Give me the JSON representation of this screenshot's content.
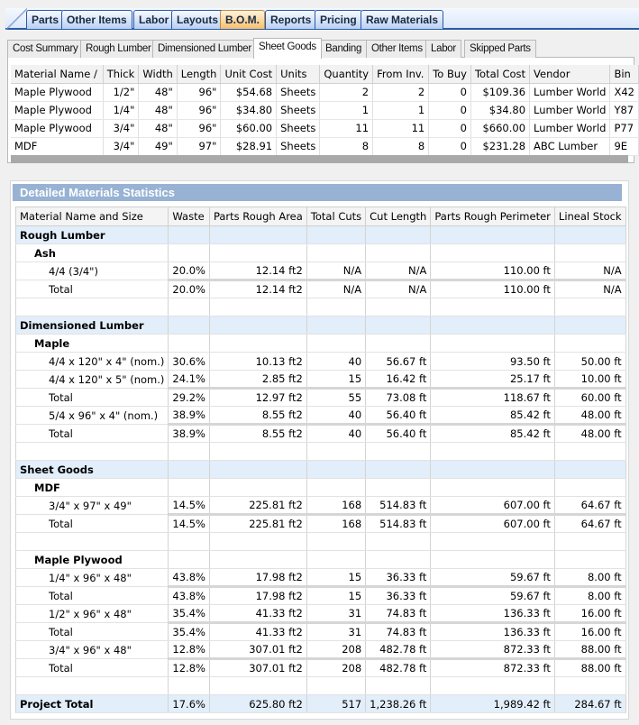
{
  "main_tabs": [
    {
      "label": "Parts",
      "active": false
    },
    {
      "label": "Other Items",
      "active": false
    },
    {
      "label": "Labor",
      "active": false
    },
    {
      "label": "Layouts",
      "active": false
    },
    {
      "label": "B.O.M.",
      "active": true
    },
    {
      "label": "Reports",
      "active": false
    },
    {
      "label": "Pricing",
      "active": false
    },
    {
      "label": "Raw Materials",
      "active": false
    }
  ],
  "sub_tabs": [
    {
      "label": "Cost Summary",
      "active": false
    },
    {
      "label": "Rough Lumber",
      "active": false
    },
    {
      "label": "Dimensioned Lumber",
      "active": false
    },
    {
      "label": "Sheet Goods",
      "active": true
    },
    {
      "label": "Banding",
      "active": false
    },
    {
      "label": "Other Items",
      "active": false
    },
    {
      "label": "Labor",
      "active": false
    },
    {
      "label": "Skipped Parts",
      "active": false
    }
  ],
  "bom_table": {
    "columns": [
      "Material Name /",
      "Thick",
      "Width",
      "Length",
      "Unit Cost",
      "Units",
      "Quantity",
      "From Inv.",
      "To Buy",
      "Total Cost",
      "Vendor",
      "Bin"
    ],
    "rows": [
      [
        "Maple Plywood",
        "1/2\"",
        "48\"",
        "96\"",
        "$54.68",
        "Sheets",
        "2",
        "2",
        "0",
        "$109.36",
        "Lumber World",
        "X42"
      ],
      [
        "Maple Plywood",
        "1/4\"",
        "48\"",
        "96\"",
        "$34.80",
        "Sheets",
        "1",
        "1",
        "0",
        "$34.80",
        "Lumber World",
        "Y87"
      ],
      [
        "Maple Plywood",
        "3/4\"",
        "48\"",
        "96\"",
        "$60.00",
        "Sheets",
        "11",
        "11",
        "0",
        "$660.00",
        "Lumber World",
        "P77"
      ],
      [
        "MDF",
        "3/4\"",
        "49\"",
        "97\"",
        "$28.91",
        "Sheets",
        "8",
        "8",
        "0",
        "$231.28",
        "ABC Lumber",
        "9E"
      ]
    ]
  },
  "stats": {
    "title": "Detailed Materials Statistics",
    "columns": [
      "Material Name and Size",
      "Waste",
      "Parts Rough Area",
      "Total Cuts",
      "Cut Length",
      "Parts Rough Perimeter",
      "Lineal Stock"
    ],
    "rows": [
      {
        "type": "cat",
        "cells": [
          "Rough Lumber",
          "",
          "",
          "",
          "",
          "",
          ""
        ]
      },
      {
        "type": "sub",
        "cells": [
          "Ash",
          "",
          "",
          "",
          "",
          "",
          ""
        ]
      },
      {
        "type": "item",
        "cells": [
          "4/4 (3/4\")",
          "20.0%",
          "12.14 ft2",
          "N/A",
          "N/A",
          "110.00 ft",
          "N/A"
        ]
      },
      {
        "type": "total",
        "cells": [
          "Total",
          "20.0%",
          "12.14 ft2",
          "N/A",
          "N/A",
          "110.00 ft",
          "N/A"
        ]
      },
      {
        "type": "blank",
        "cells": [
          "",
          "",
          "",
          "",
          "",
          "",
          ""
        ]
      },
      {
        "type": "cat",
        "cells": [
          "Dimensioned Lumber",
          "",
          "",
          "",
          "",
          "",
          ""
        ]
      },
      {
        "type": "sub",
        "cells": [
          "Maple",
          "",
          "",
          "",
          "",
          "",
          ""
        ]
      },
      {
        "type": "item",
        "cells": [
          "4/4 x 120\" x 4\" (nom.)",
          "30.6%",
          "10.13 ft2",
          "40",
          "56.67 ft",
          "93.50 ft",
          "50.00 ft"
        ]
      },
      {
        "type": "item",
        "cells": [
          "4/4 x 120\" x 5\" (nom.)",
          "24.1%",
          "2.85 ft2",
          "15",
          "16.42 ft",
          "25.17 ft",
          "10.00 ft"
        ]
      },
      {
        "type": "total",
        "cells": [
          "Total",
          "29.2%",
          "12.97 ft2",
          "55",
          "73.08 ft",
          "118.67 ft",
          "60.00 ft"
        ]
      },
      {
        "type": "item",
        "cells": [
          "5/4 x 96\" x 4\" (nom.)",
          "38.9%",
          "8.55 ft2",
          "40",
          "56.40 ft",
          "85.42 ft",
          "48.00 ft"
        ]
      },
      {
        "type": "total",
        "cells": [
          "Total",
          "38.9%",
          "8.55 ft2",
          "40",
          "56.40 ft",
          "85.42 ft",
          "48.00 ft"
        ]
      },
      {
        "type": "blank",
        "cells": [
          "",
          "",
          "",
          "",
          "",
          "",
          ""
        ]
      },
      {
        "type": "cat",
        "cells": [
          "Sheet Goods",
          "",
          "",
          "",
          "",
          "",
          ""
        ]
      },
      {
        "type": "sub",
        "cells": [
          "MDF",
          "",
          "",
          "",
          "",
          "",
          ""
        ]
      },
      {
        "type": "item",
        "cells": [
          "3/4\" x 97\" x 49\"",
          "14.5%",
          "225.81 ft2",
          "168",
          "514.83 ft",
          "607.00 ft",
          "64.67 ft"
        ]
      },
      {
        "type": "total",
        "cells": [
          "Total",
          "14.5%",
          "225.81 ft2",
          "168",
          "514.83 ft",
          "607.00 ft",
          "64.67 ft"
        ]
      },
      {
        "type": "blank",
        "cells": [
          "",
          "",
          "",
          "",
          "",
          "",
          ""
        ]
      },
      {
        "type": "sub",
        "cells": [
          "Maple Plywood",
          "",
          "",
          "",
          "",
          "",
          ""
        ]
      },
      {
        "type": "item",
        "cells": [
          "1/4\" x 96\" x 48\"",
          "43.8%",
          "17.98 ft2",
          "15",
          "36.33 ft",
          "59.67 ft",
          "8.00 ft"
        ]
      },
      {
        "type": "total",
        "cells": [
          "Total",
          "43.8%",
          "17.98 ft2",
          "15",
          "36.33 ft",
          "59.67 ft",
          "8.00 ft"
        ]
      },
      {
        "type": "item",
        "cells": [
          "1/2\" x 96\" x 48\"",
          "35.4%",
          "41.33 ft2",
          "31",
          "74.83 ft",
          "136.33 ft",
          "16.00 ft"
        ]
      },
      {
        "type": "total",
        "cells": [
          "Total",
          "35.4%",
          "41.33 ft2",
          "31",
          "74.83 ft",
          "136.33 ft",
          "16.00 ft"
        ]
      },
      {
        "type": "item",
        "cells": [
          "3/4\" x 96\" x 48\"",
          "12.8%",
          "307.01 ft2",
          "208",
          "482.78 ft",
          "872.33 ft",
          "88.00 ft"
        ]
      },
      {
        "type": "total",
        "cells": [
          "Total",
          "12.8%",
          "307.01 ft2",
          "208",
          "482.78 ft",
          "872.33 ft",
          "88.00 ft"
        ]
      },
      {
        "type": "blank",
        "cells": [
          "",
          "",
          "",
          "",
          "",
          "",
          ""
        ]
      },
      {
        "type": "grand",
        "cells": [
          "Project Total",
          "17.6%",
          "625.80 ft2",
          "517",
          "1,238.26 ft",
          "1,989.42 ft",
          "284.67 ft"
        ]
      }
    ]
  }
}
